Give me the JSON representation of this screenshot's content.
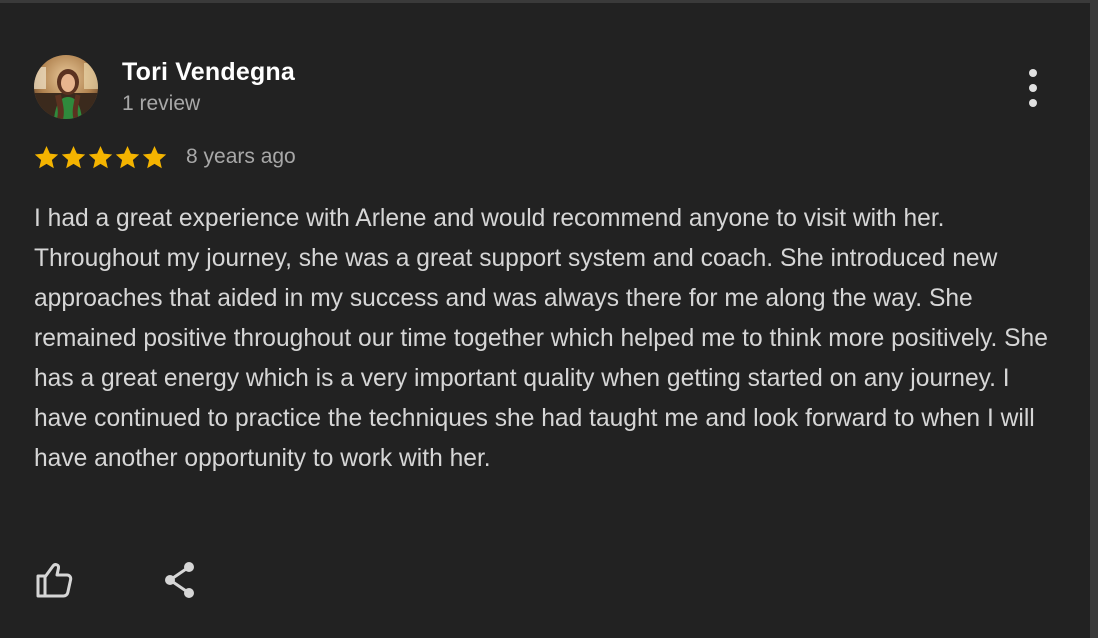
{
  "reviewer": {
    "name": "Tori Vendegna",
    "review_count": "1 review"
  },
  "rating": {
    "stars": 5,
    "max_stars": 5,
    "star_color": "#f4b400"
  },
  "time_ago": "8 years ago",
  "review_text": "I had a great experience with Arlene and would recommend anyone to visit with her. Throughout my journey, she was a great support system and coach. She introduced new approaches that aided in my success and was always there for me along the way. She remained positive throughout our time together which helped me to think more positively. She has a great energy which is a very important quality when getting started on any journey. I have continued to practice the techniques she had taught me and look forward to when I will have another opportunity to work with her.",
  "actions": {
    "like_icon": "thumbs-up-icon",
    "share_icon": "share-icon",
    "more_icon": "more-vert-icon"
  },
  "colors": {
    "background": "#222222",
    "name": "#ffffff",
    "secondary_text": "#a8a8a8",
    "body_text": "#d6d6d6"
  }
}
